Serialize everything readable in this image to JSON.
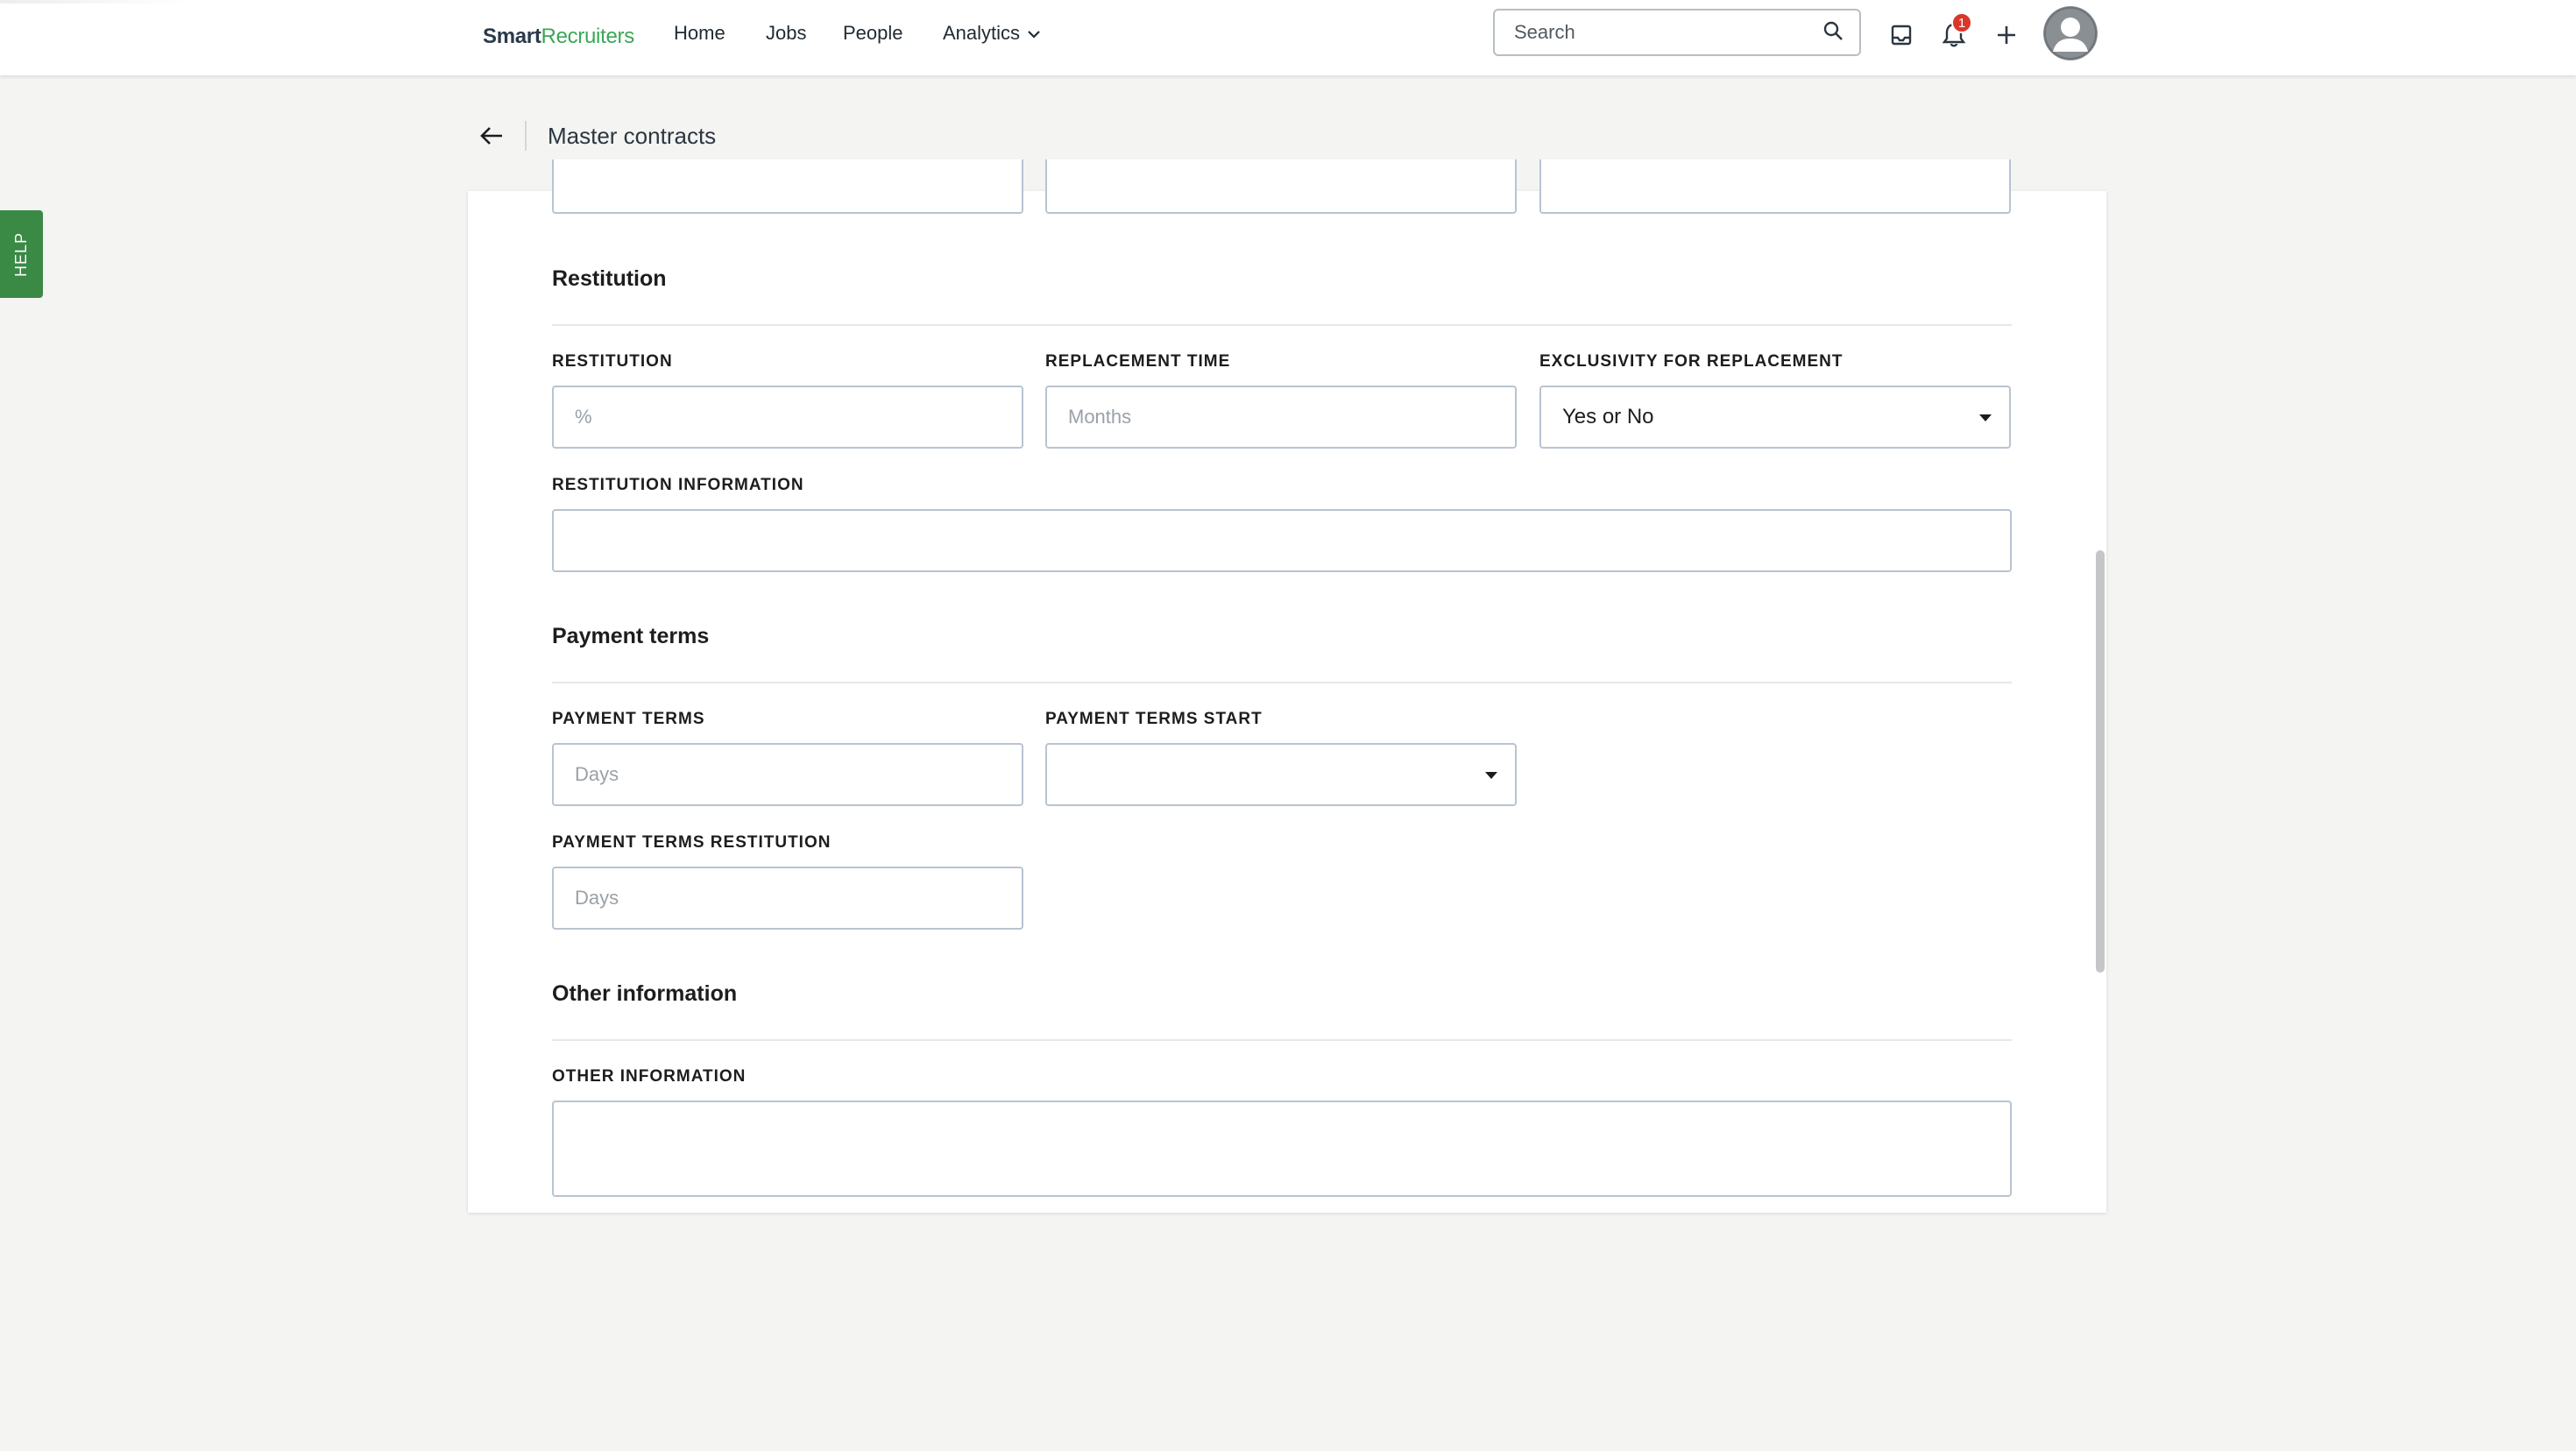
{
  "nav": {
    "logo_part1": "Smart",
    "logo_part2": "Recruiters",
    "items": [
      {
        "label": "Home"
      },
      {
        "label": "Jobs"
      },
      {
        "label": "People"
      },
      {
        "label": "Analytics"
      }
    ],
    "search_placeholder": "Search",
    "notification_count": "1"
  },
  "header": {
    "title": "Master contracts"
  },
  "help_label": "HELP",
  "sections": {
    "restitution": {
      "title": "Restitution",
      "restitution_label": "RESTITUTION",
      "restitution_placeholder": "%",
      "replacement_time_label": "REPLACEMENT TIME",
      "replacement_time_placeholder": "Months",
      "exclusivity_label": "EXCLUSIVITY FOR REPLACEMENT",
      "exclusivity_value": "Yes or No",
      "info_label": "RESTITUTION INFORMATION",
      "info_value": ""
    },
    "payment_terms": {
      "title": "Payment terms",
      "terms_label": "PAYMENT TERMS",
      "terms_placeholder": "Days",
      "terms_start_label": "PAYMENT TERMS START",
      "terms_start_value": "",
      "terms_restitution_label": "PAYMENT TERMS RESTITUTION",
      "terms_restitution_placeholder": "Days"
    },
    "other": {
      "title": "Other information",
      "info_label": "OTHER INFORMATION",
      "info_value": ""
    }
  },
  "colors": {
    "brand_green": "#3aa757",
    "help_tab": "#3a8a45",
    "badge_red": "#d9372b",
    "field_border": "#b8c4d1"
  }
}
